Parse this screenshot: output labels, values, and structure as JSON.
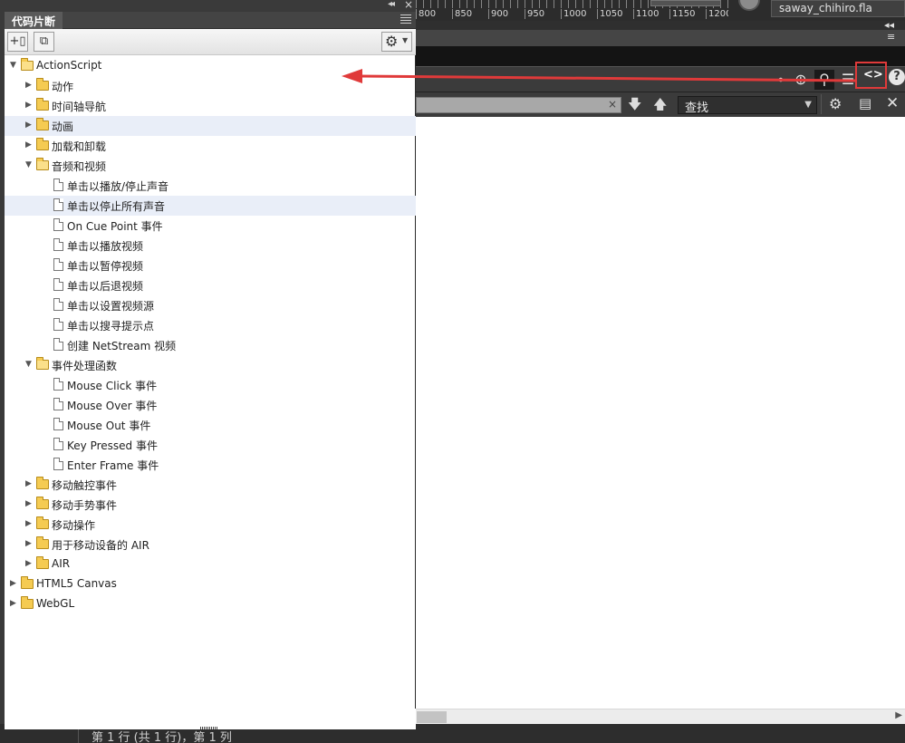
{
  "app": {
    "file_tab": "saway_chihiro.fla",
    "ruler_labels": [
      "800",
      "850",
      "900",
      "950",
      "1000",
      "1050",
      "1100",
      "1150",
      "1200"
    ],
    "status_text": "第 1 行 (共 1 行)，第 1 列"
  },
  "toolbar": {
    "icons": [
      "pin-icon",
      "target-icon",
      "zoom-icon",
      "list-icon",
      "code-view-icon",
      "help-icon"
    ],
    "code_view_label": "<>",
    "help_label": "?"
  },
  "find": {
    "input_value": "",
    "select_value": "查找",
    "clear_label": "×"
  },
  "panel": {
    "title": "代码片断",
    "collapse_label": "◂◂",
    "close_label": "×"
  },
  "tree": [
    {
      "level": 0,
      "type": "folder",
      "open": true,
      "label": "ActionScript"
    },
    {
      "level": 1,
      "type": "folder",
      "open": false,
      "label": "动作"
    },
    {
      "level": 1,
      "type": "folder",
      "open": false,
      "label": "时间轴导航"
    },
    {
      "level": 1,
      "type": "folder",
      "open": false,
      "label": "动画",
      "highlight": true
    },
    {
      "level": 1,
      "type": "folder",
      "open": false,
      "label": "加载和卸载"
    },
    {
      "level": 1,
      "type": "folder",
      "open": true,
      "label": "音频和视频"
    },
    {
      "level": 2,
      "type": "file",
      "label": "单击以播放/停止声音"
    },
    {
      "level": 2,
      "type": "file",
      "label": "单击以停止所有声音",
      "highlight": true
    },
    {
      "level": 2,
      "type": "file",
      "label": "On Cue Point 事件"
    },
    {
      "level": 2,
      "type": "file",
      "label": "单击以播放视频"
    },
    {
      "level": 2,
      "type": "file",
      "label": "单击以暂停视频"
    },
    {
      "level": 2,
      "type": "file",
      "label": "单击以后退视频"
    },
    {
      "level": 2,
      "type": "file",
      "label": "单击以设置视频源"
    },
    {
      "level": 2,
      "type": "file",
      "label": "单击以搜寻提示点"
    },
    {
      "level": 2,
      "type": "file",
      "label": "创建 NetStream 视频"
    },
    {
      "level": 1,
      "type": "folder",
      "open": true,
      "label": "事件处理函数"
    },
    {
      "level": 2,
      "type": "file",
      "label": "Mouse Click 事件"
    },
    {
      "level": 2,
      "type": "file",
      "label": "Mouse Over 事件"
    },
    {
      "level": 2,
      "type": "file",
      "label": "Mouse Out 事件"
    },
    {
      "level": 2,
      "type": "file",
      "label": "Key Pressed 事件"
    },
    {
      "level": 2,
      "type": "file",
      "label": "Enter Frame 事件"
    },
    {
      "level": 1,
      "type": "folder",
      "open": false,
      "label": "移动触控事件"
    },
    {
      "level": 1,
      "type": "folder",
      "open": false,
      "label": "移动手势事件"
    },
    {
      "level": 1,
      "type": "folder",
      "open": false,
      "label": "移动操作"
    },
    {
      "level": 1,
      "type": "folder",
      "open": false,
      "label": "用于移动设备的 AIR"
    },
    {
      "level": 1,
      "type": "folder",
      "open": false,
      "label": "AIR"
    },
    {
      "level": 0,
      "type": "folder",
      "open": false,
      "label": "HTML5 Canvas"
    },
    {
      "level": 0,
      "type": "folder",
      "open": false,
      "label": "WebGL"
    }
  ],
  "colors": {
    "annotation_red": "#e03a3a",
    "row_highlight": "#e9eef8",
    "folder_yellow": "#f5cb52"
  }
}
